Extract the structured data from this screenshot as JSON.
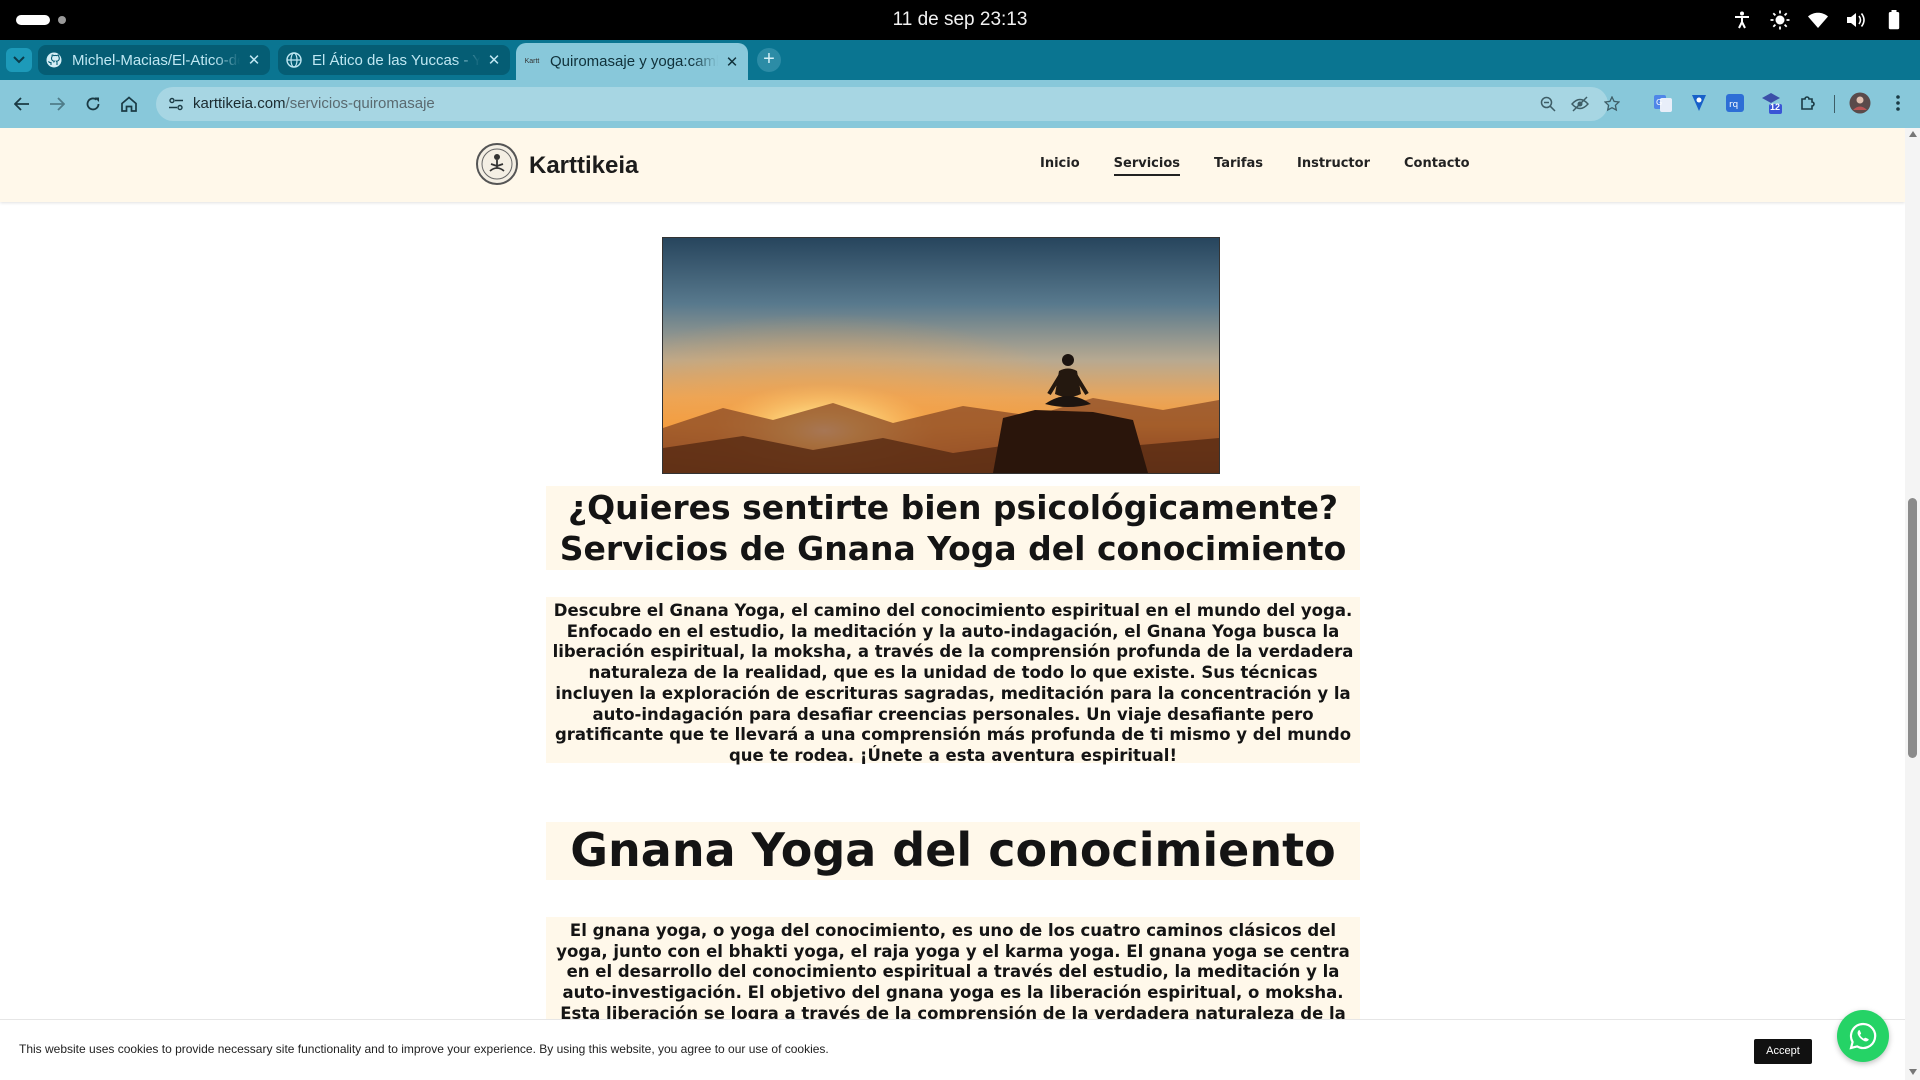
{
  "os": {
    "clock": "11 de sep  23:13",
    "tray_icons": [
      "accessibility-icon",
      "brightness-icon",
      "wifi-icon",
      "volume-icon",
      "battery-icon"
    ]
  },
  "browser": {
    "tabs": [
      {
        "title": "Michel-Macias/El-Atico-de-las-Yuccas",
        "favicon": "github-icon",
        "active": false
      },
      {
        "title": "El Ático de las Yuccas - Yoga",
        "favicon": "globe-icon",
        "active": false
      },
      {
        "title": "Quiromasaje y yoga:cambia tu vida",
        "favicon": "Kartt",
        "active": true
      }
    ],
    "new_tab": "+",
    "url_host": "karttikeia.com",
    "url_path": "/servicios-quiromasaje",
    "extension_badge": "12"
  },
  "site": {
    "brand": "Karttikeia",
    "nav": [
      "Inicio",
      "Servicios",
      "Tarifas",
      "Instructor",
      "Contacto"
    ],
    "nav_current": "Servicios",
    "heading_1_line_1": "¿Quieres sentirte bien psicológicamente?",
    "heading_1_line_2": "Servicios de Gnana Yoga del conocimiento",
    "paragraph_1": "Descubre el Gnana Yoga, el camino del conocimiento espiritual en el mundo del yoga. Enfocado en el estudio, la meditación y la auto-indagación, el Gnana Yoga busca la liberación espiritual, la moksha, a través de la comprensión profunda de la verdadera naturaleza de la realidad, que es la unidad de todo lo que existe. Sus técnicas incluyen la exploración de escrituras sagradas, meditación para la concentración y la auto-indagación para desafiar creencias personales. Un viaje desafiante pero gratificante que te llevará a una comprensión más profunda de ti mismo y del mundo que te rodea. ¡Únete a esta aventura espiritual!",
    "heading_2": "Gnana Yoga del conocimiento",
    "paragraph_2": "El gnana yoga, o yoga del conocimiento, es uno de los cuatro caminos clásicos del yoga, junto con el bhakti yoga, el raja yoga y el karma yoga. El gnana yoga se centra en el desarrollo del conocimiento espiritual a través del estudio, la meditación y la auto-investigación. El objetivo del gnana yoga es la liberación espiritual, o moksha. Esta liberación se logra a través de la comprensión de la verdadera naturaleza de la realidad,"
  },
  "cookie_banner": {
    "text": "This website uses cookies to provide necessary site functionality and to improve your experience. By using this website, you agree to our use of cookies.",
    "accept": "Accept"
  },
  "colors": {
    "tab_strip": "#0a7591",
    "toolbar": "#88c8da",
    "site_header": "#fff8ea",
    "whatsapp": "#25d366"
  }
}
